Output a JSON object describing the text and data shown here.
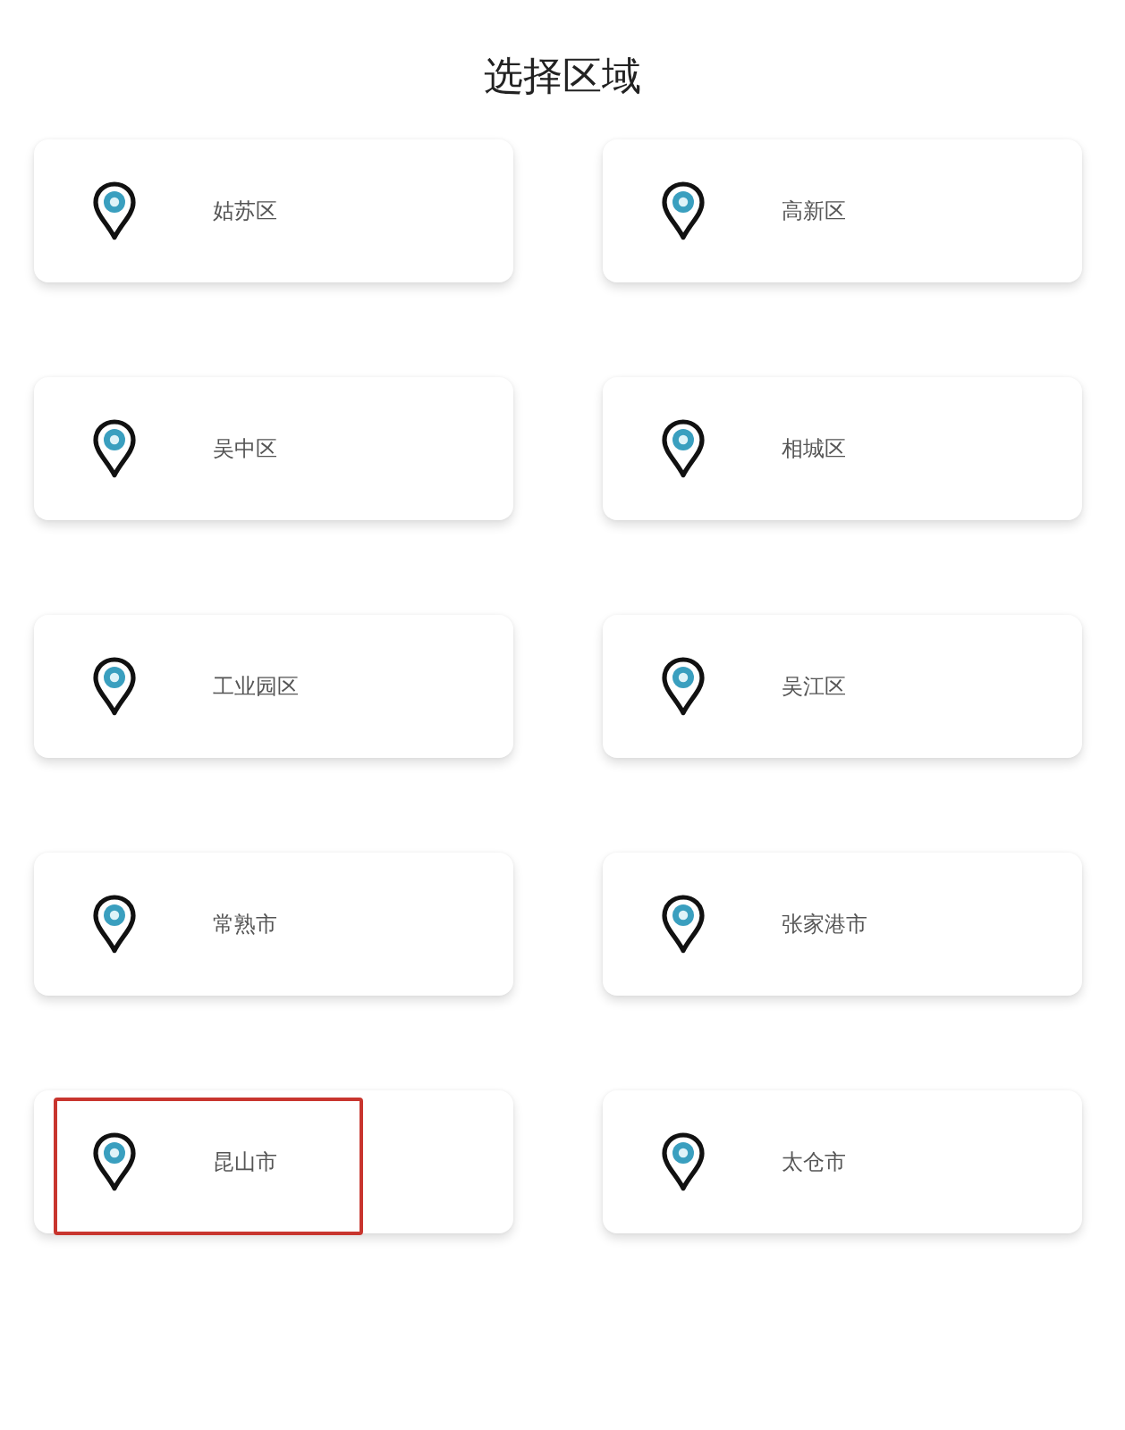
{
  "title": "选择区域",
  "regions": [
    {
      "name": "姑苏区",
      "highlighted": false
    },
    {
      "name": "高新区",
      "highlighted": false
    },
    {
      "name": "吴中区",
      "highlighted": false
    },
    {
      "name": "相城区",
      "highlighted": false
    },
    {
      "name": "工业园区",
      "highlighted": false
    },
    {
      "name": "吴江区",
      "highlighted": false
    },
    {
      "name": "常熟市",
      "highlighted": false
    },
    {
      "name": "张家港市",
      "highlighted": false
    },
    {
      "name": "昆山市",
      "highlighted": true
    },
    {
      "name": "太仓市",
      "highlighted": false
    }
  ]
}
